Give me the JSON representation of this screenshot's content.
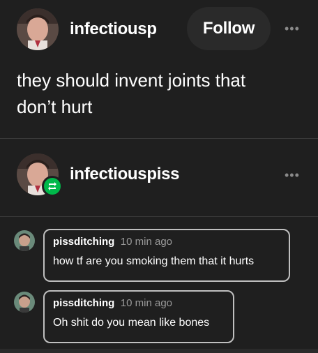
{
  "post": {
    "username": "infectiousp",
    "follow_label": "Follow",
    "more_label": "•••",
    "body_line1": "they should invent joints that",
    "body_line2": "don’t hurt"
  },
  "reblog": {
    "username": "infectiouspiss",
    "more_label": "•••"
  },
  "replies": [
    {
      "username": "pissditching",
      "time": "10 min ago",
      "text": "how tf are you smoking them that it hurts"
    },
    {
      "username": "pissditching",
      "time": "10 min ago",
      "text": "Oh shit do you mean like bones"
    }
  ],
  "colors": {
    "background": "#1f1f1f",
    "follow_button_bg": "#2a2a2a",
    "reblog_badge": "#00b84a",
    "bubble_border": "#bfbfbf",
    "muted_text": "#9a9a9a"
  },
  "icons": {
    "more": "more-horizontal-icon",
    "reblog": "reblog-icon"
  }
}
